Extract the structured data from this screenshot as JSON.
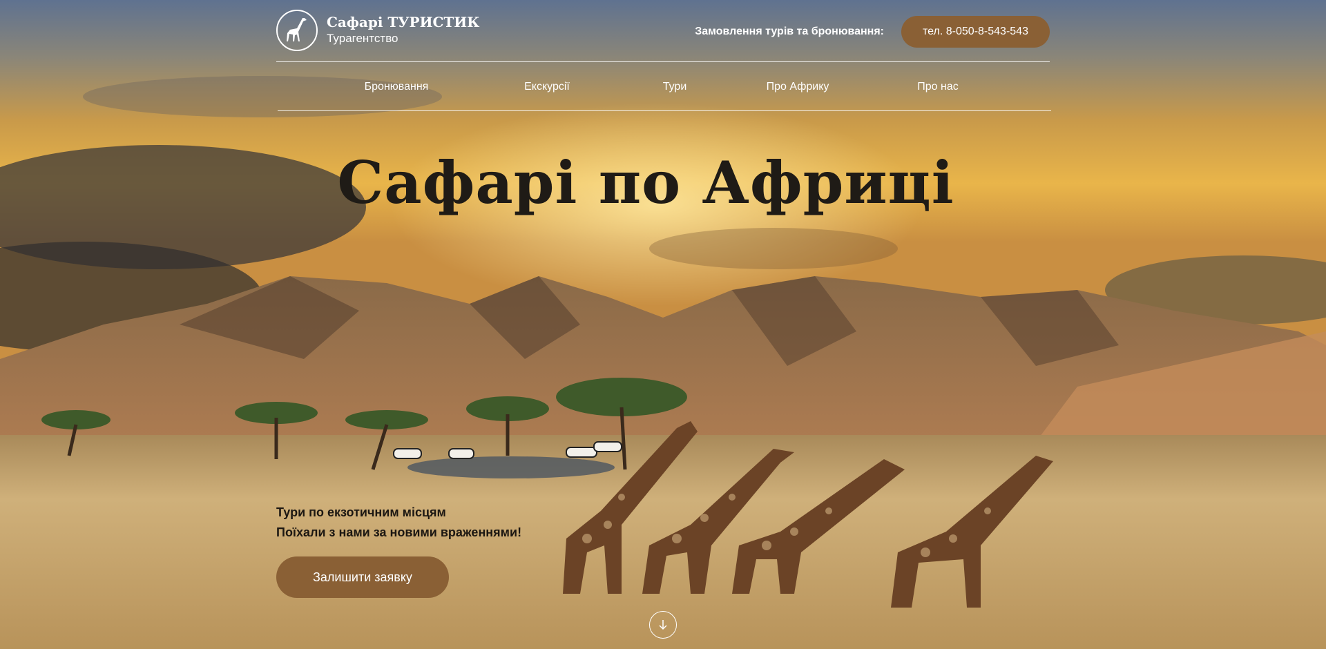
{
  "brand": {
    "name": "Сафарі ТУРИСТИК",
    "subtitle": "Турагентство",
    "logo_icon": "giraffe-icon"
  },
  "header": {
    "order_label": "Замовлення турів та бронювання:",
    "phone_label": "тел. 8-050-8-543-543"
  },
  "nav": {
    "items": [
      {
        "label": "Бронювання"
      },
      {
        "label": "Екскурсії"
      },
      {
        "label": "Тури"
      },
      {
        "label": "Про Африку"
      },
      {
        "label": "Про нас"
      }
    ]
  },
  "hero": {
    "title": "Сафарі по Африці",
    "tagline_line1": "Тури по екзотичним місцям",
    "tagline_line2": "Поїхали з нами за новими враженнями!",
    "cta_label": "Залишити заявку",
    "scroll_icon": "arrow-down-icon"
  },
  "colors": {
    "accent": "#8a6035",
    "text_dark": "#1f1b16",
    "header_text": "#ffffff"
  }
}
